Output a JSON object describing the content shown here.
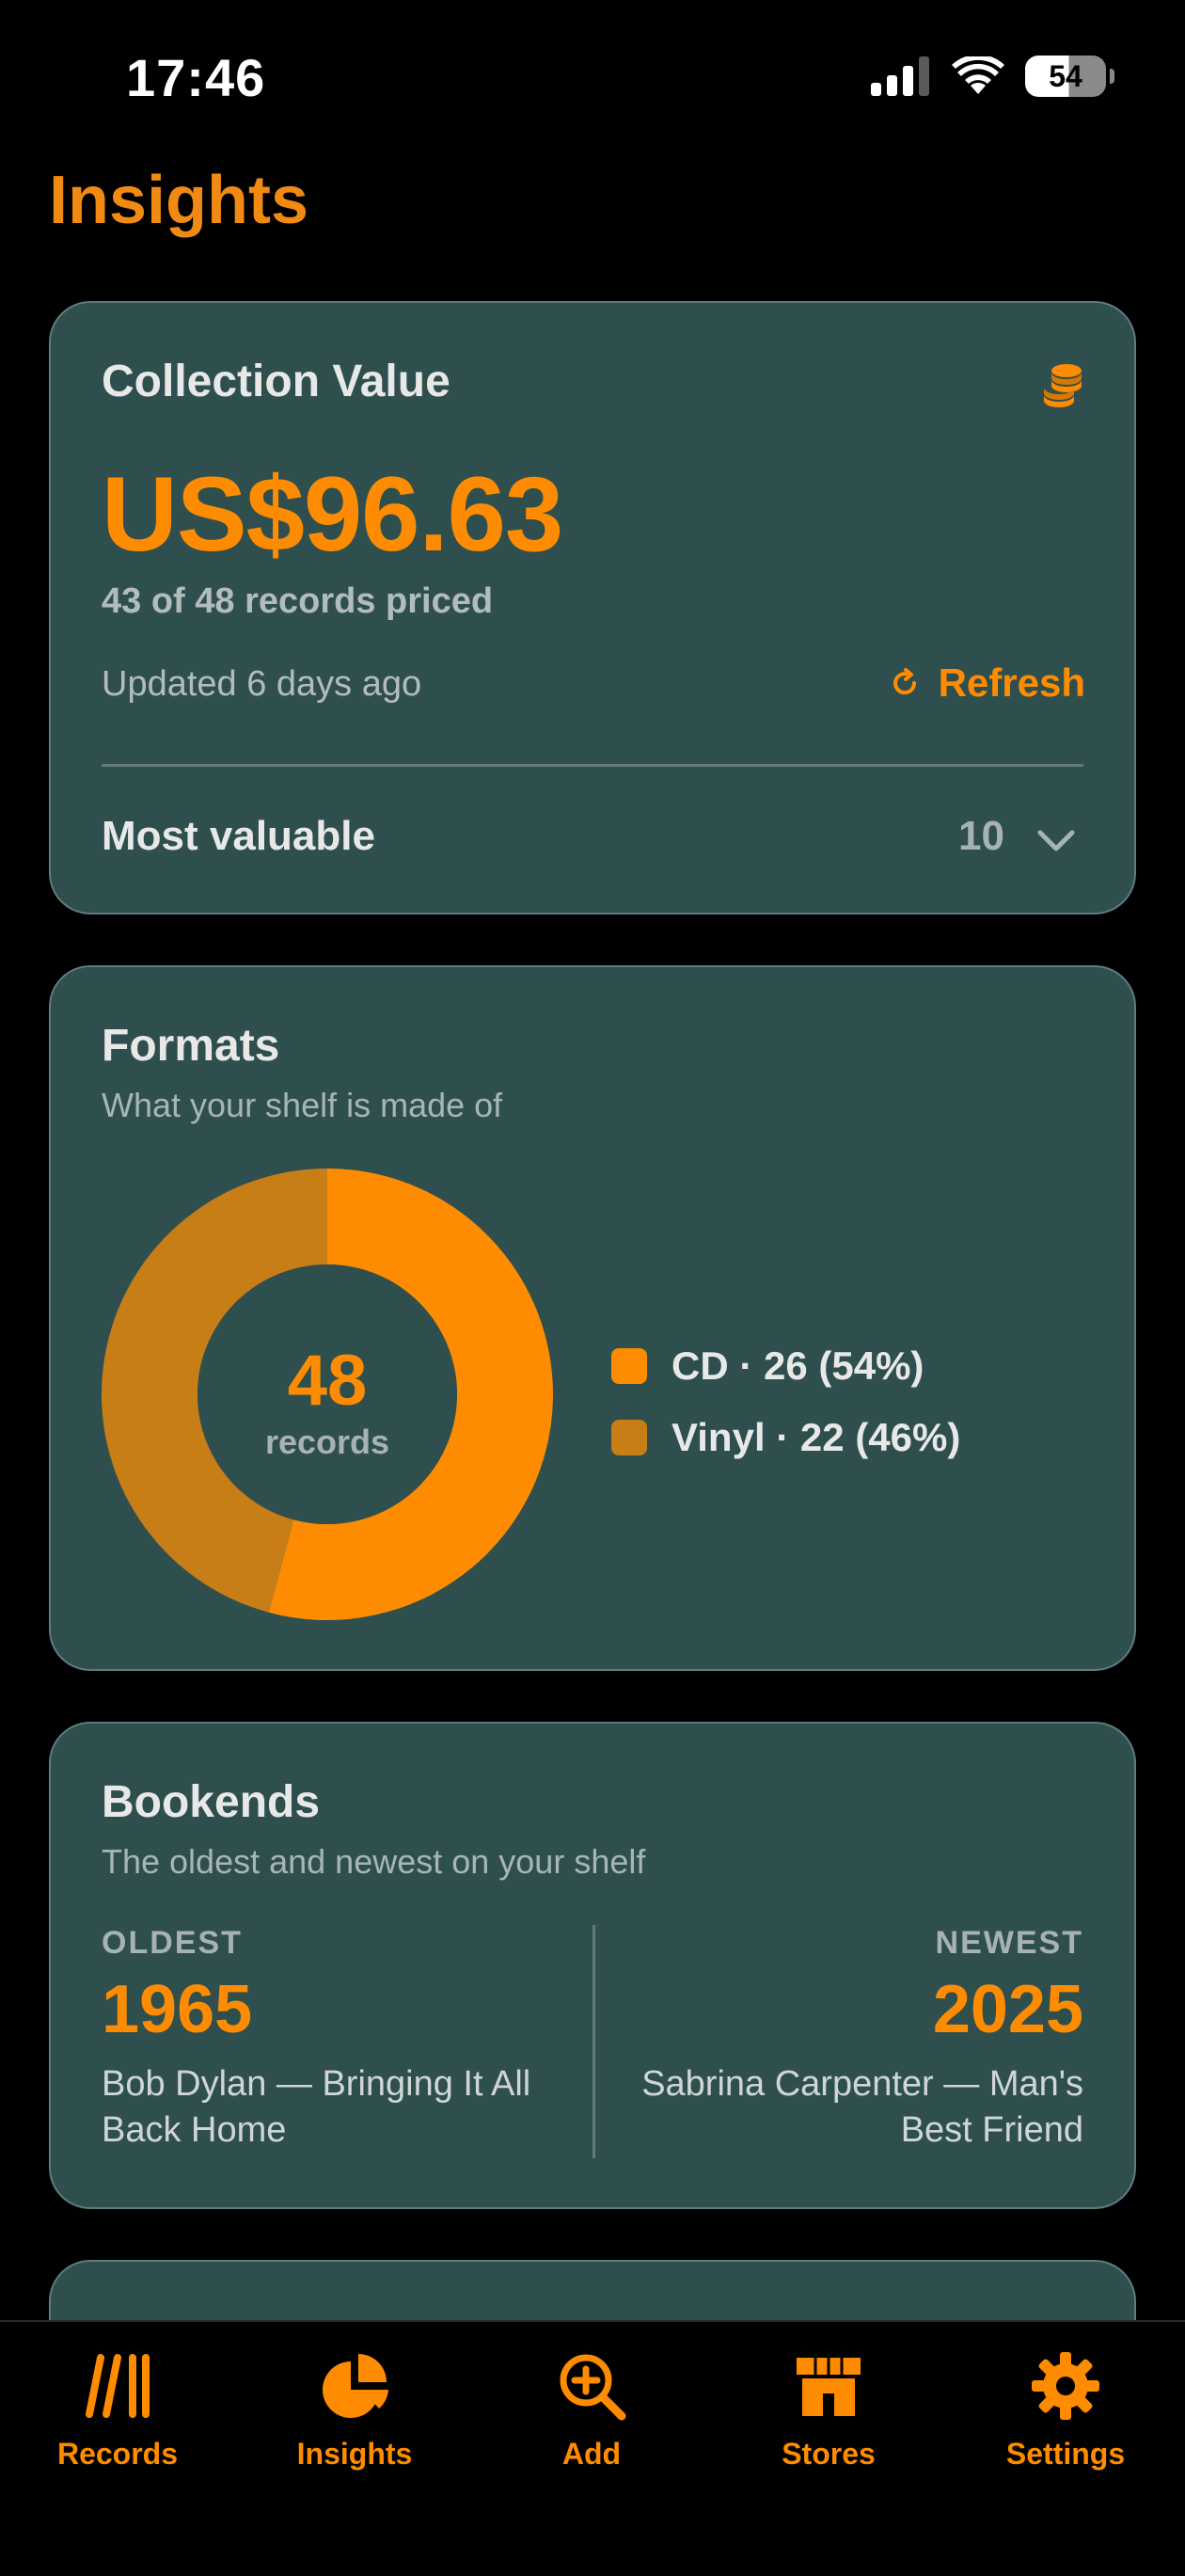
{
  "status_bar": {
    "time": "17:46",
    "battery": "54",
    "icons": [
      "cellular-signal-icon",
      "wifi-icon",
      "battery-icon"
    ]
  },
  "page": {
    "title": "Insights"
  },
  "colors": {
    "accent": "#ff8c00",
    "accent_dark": "#c87e17",
    "card_background": "#2f4f4f",
    "page_background": "#000000"
  },
  "collection_value": {
    "title": "Collection Value",
    "icon": "coins-icon",
    "amount": "US$96.63",
    "priced": "43 of 48 records priced",
    "updated": "Updated 6 days ago",
    "refresh_label": "Refresh",
    "most_valuable_label": "Most valuable",
    "most_valuable_count": "10"
  },
  "formats": {
    "title": "Formats",
    "subtitle": "What your shelf is made of",
    "total": "48",
    "total_label": "records",
    "items": [
      {
        "label": "CD · 26 (54%)",
        "count": 26,
        "color": "#ff8c00"
      },
      {
        "label": "Vinyl · 22 (46%)",
        "count": 22,
        "color": "#c87e17"
      }
    ]
  },
  "bookends": {
    "title": "Bookends",
    "subtitle": "The oldest and newest on your shelf",
    "oldest": {
      "tag": "OLDEST",
      "year": "1965",
      "record": "Bob Dylan — Bringing It All Back Home"
    },
    "newest": {
      "tag": "NEWEST",
      "year": "2025",
      "record": "Sabrina Carpenter — Man's Best Friend"
    }
  },
  "tab_bar": {
    "tabs": [
      {
        "label": "Records",
        "icon": "records-icon"
      },
      {
        "label": "Insights",
        "icon": "pie-chart-icon",
        "selected": true
      },
      {
        "label": "Add",
        "icon": "add-search-icon"
      },
      {
        "label": "Stores",
        "icon": "storefront-icon"
      },
      {
        "label": "Settings",
        "icon": "gear-icon"
      }
    ]
  }
}
